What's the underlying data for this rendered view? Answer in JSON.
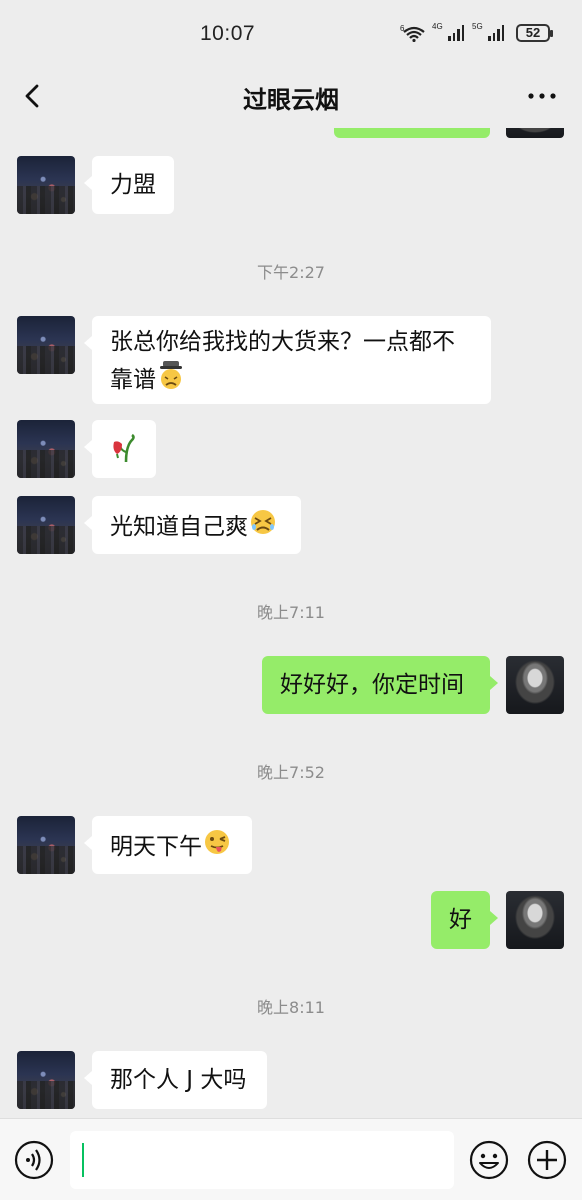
{
  "status_bar": {
    "time": "10:07",
    "battery": "52",
    "net1": "6",
    "net2": "4G",
    "net3": "5G"
  },
  "nav": {
    "title": "过眼云烟"
  },
  "messages": [
    {
      "text": "力盟"
    },
    {
      "text": "下午2:27"
    },
    {
      "text_line1": "张总你给我找的大货来？一点都不",
      "text_line2": "靠谱"
    },
    {
      "text": ""
    },
    {
      "text": "光知道自己爽"
    },
    {
      "text": "晚上7:11"
    },
    {
      "text": "好好好，你定时间"
    },
    {
      "text": "晚上7:52"
    },
    {
      "text": "明天下午"
    },
    {
      "text": "好"
    },
    {
      "text": "晚上8:11"
    },
    {
      "text": "那个人 J 大吗"
    }
  ],
  "icons": {
    "back": "chevron-left-icon",
    "more": "more-dots-icon",
    "voice": "voice-icon",
    "emoji": "smiley-icon",
    "plus": "plus-icon",
    "emoji_1": "frowning-with-hat-emoji",
    "emoji_2": "wilted-flower-emoji",
    "emoji_3": "tired-face-emoji",
    "emoji_4": "winking-tongue-emoji"
  },
  "colors": {
    "background": "#ededed",
    "outgoing": "#95ec69",
    "incoming": "#ffffff",
    "accent": "#07c160"
  }
}
